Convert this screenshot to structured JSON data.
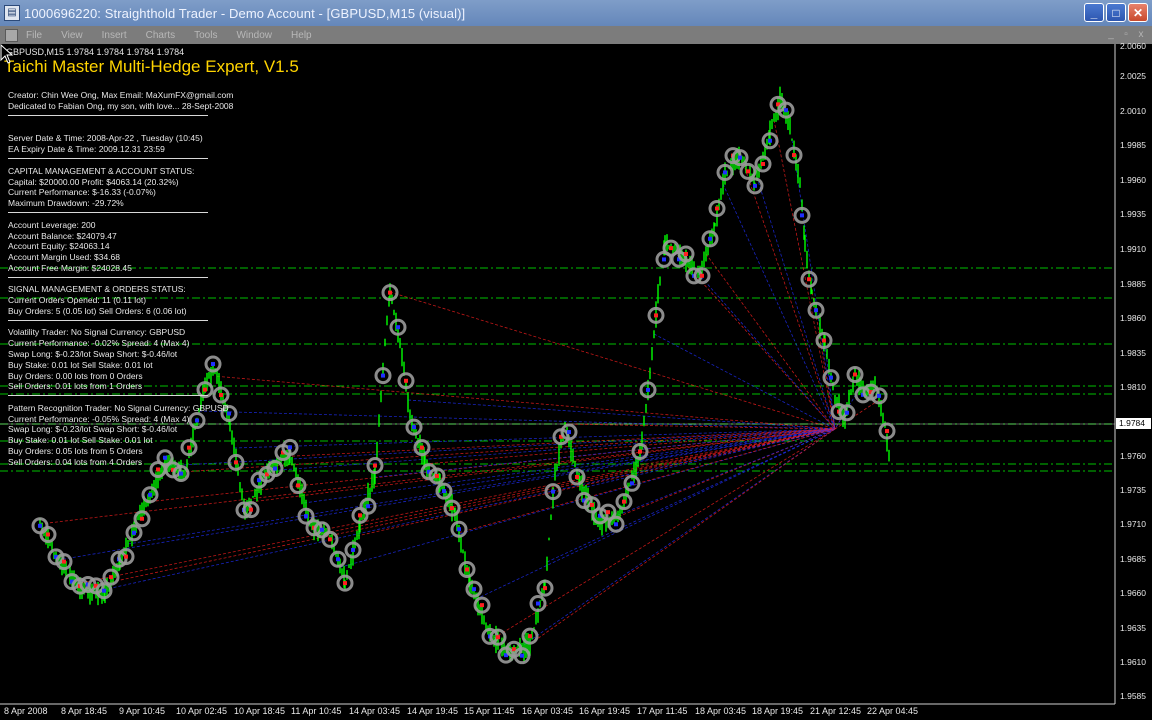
{
  "window": {
    "title": "1000696220: Straighthold Trader - Demo Account - [GBPUSD,M15 (visual)]",
    "minimize": "_",
    "maximize": "□",
    "close": "✕"
  },
  "menu": {
    "items": [
      "File",
      "View",
      "Insert",
      "Charts",
      "Tools",
      "Window",
      "Help"
    ],
    "mdi": [
      "_",
      "▫",
      "x"
    ]
  },
  "chart": {
    "symbol_line": "GBPUSD,M15  1.9784  1.9784  1.9784  1.9784",
    "ea_title": "Taichi Master Multi-Hedge Expert, V1.5",
    "info_lines": [
      "Creator: Chin Wee Ong, Max   Email: MaXumFX@gmail.com",
      "Dedicated to Fabian Ong, my son, with love... 28-Sept-2008",
      "Server Date & Time: 2008-Apr-22 , Tuesday (10:45)",
      "EA Expiry Date & Time: 2009.12.31 23:59",
      "CAPITAL MANAGEMENT & ACCOUNT STATUS:",
      "Capital: $20000.00   Profit: $4063.14 (20.32%)",
      "Current Performance: $-16.33 (-0.07%)",
      "Maximum Drawdown: -29.72%",
      "Account Leverage: 200",
      "Account Balance: $24079.47",
      "Account Equity: $24063.14",
      "Account Margin Used: $34.68",
      "Account Free Margin: $24028.45",
      "SIGNAL MANAGEMENT & ORDERS STATUS:",
      "Current Orders Opened: 11 (0.11 lot)",
      "Buy Orders: 5 (0.05 lot)   Sell Orders: 6 (0.06 lot)",
      "Volatility Trader: No Signal   Currency: GBPUSD",
      "Current Performance: -0.02%   Spread: 4 (Max 4)",
      "Swap Long: $-0.23/lot   Swap Short: $-0.46/lot",
      "Buy Stake: 0.01 lot      Sell Stake: 0.01 lot",
      "Buy Orders: 0.00 lots from 0 Orders",
      "Sell Orders: 0.01 lots from 1 Orders",
      "Pattern Recognition Trader: No Signal   Currency: GBPUSD",
      "Current Performance: -0.05%   Spread: 4 (Max 4)",
      "Swap Long: $-0.23/lot   Swap Short: $-0.46/lot",
      "Buy Stake: 0.01 lot      Sell Stake: 0.01 lot",
      "Buy Orders: 0.05 lots from 5 Orders",
      "Sell Orders: 0.04 lots from 4 Orders"
    ],
    "price_labels": [
      "2.0060",
      "2.0025",
      "2.0010",
      "1.9985",
      "1.9960",
      "1.9935",
      "1.9910",
      "1.9885",
      "1.9860",
      "1.9835",
      "1.9810",
      "1.9784",
      "1.9760",
      "1.9735",
      "1.9710",
      "1.9685",
      "1.9660",
      "1.9635",
      "1.9610",
      "1.9585"
    ],
    "current_price": "1.9784",
    "time_labels": [
      "8 Apr 2008",
      "8 Apr 18:45",
      "9 Apr 10:45",
      "10 Apr 02:45",
      "10 Apr 18:45",
      "11 Apr 10:45",
      "14 Apr 03:45",
      "14 Apr 19:45",
      "15 Apr 11:45",
      "16 Apr 03:45",
      "16 Apr 19:45",
      "17 Apr 11:45",
      "18 Apr 03:45",
      "18 Apr 19:45",
      "21 Apr 12:45",
      "22 Apr 04:45"
    ],
    "colors": {
      "candle": "#00ff00",
      "sell_line": "#ff2020",
      "buy_line": "#2030ff",
      "order_marker": "#9a9a9a",
      "level_line": "#00c000",
      "ea_title": "#ffd400"
    }
  }
}
